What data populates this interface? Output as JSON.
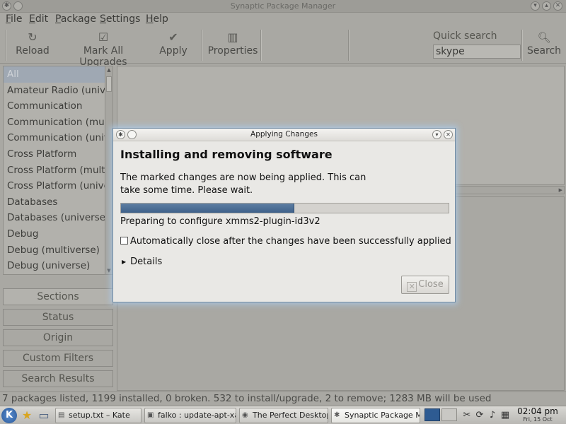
{
  "main_window": {
    "title": "Synaptic Package Manager",
    "menu": [
      "File",
      "Edit",
      "Package",
      "Settings",
      "Help"
    ],
    "toolbar": {
      "reload": "Reload",
      "mark_all": "Mark All Upgrades",
      "apply": "Apply",
      "properties": "Properties",
      "quick_search_label": "Quick search",
      "quick_search_value": "skype",
      "search": "Search"
    },
    "sections": [
      "All",
      "Amateur Radio (universe)",
      "Communication",
      "Communication (multiverse)",
      "Communication (universe)",
      "Cross Platform",
      "Cross Platform (multiverse)",
      "Cross Platform (universe)",
      "Databases",
      "Databases (universe)",
      "Debug",
      "Debug (multiverse)",
      "Debug (universe)"
    ],
    "filter_buttons": [
      "Sections",
      "Status",
      "Origin",
      "Custom Filters",
      "Search Results"
    ],
    "status_bar": "7 packages listed, 1199 installed, 0 broken. 532 to install/upgrade, 2 to remove; 1283 MB will be used"
  },
  "dialog": {
    "title": "Applying Changes",
    "heading": "Installing and removing software",
    "message": "The marked changes are now being applied. This can take some time. Please wait.",
    "progress": 0.53,
    "status": "Preparing to configure xmms2-plugin-id3v2",
    "auto_close_label": "Automatically close after the changes have been successfully applied",
    "auto_close_checked": false,
    "details_label": "Details",
    "close_label": "Close"
  },
  "taskbar": {
    "tasks": [
      {
        "label": "setup.txt – Kate",
        "icon": "kate-icon"
      },
      {
        "label": "falko : update-apt-xapi",
        "icon": "terminal-icon"
      },
      {
        "label": "The Perfect Desktop -",
        "icon": "browser-icon"
      },
      {
        "label": "Synaptic Package Mana",
        "icon": "synaptic-icon"
      }
    ],
    "clock_time": "02:04 pm",
    "clock_date": "Fri, 15 Oct"
  }
}
